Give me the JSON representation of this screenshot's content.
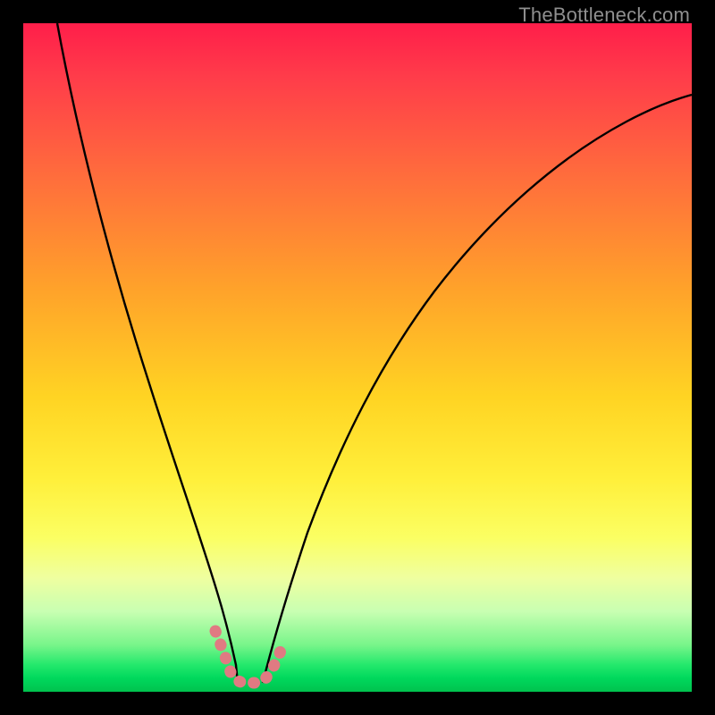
{
  "watermark": "TheBottleneck.com",
  "chart_data": {
    "type": "line",
    "title": "",
    "xlabel": "",
    "ylabel": "",
    "xlim": [
      0,
      100
    ],
    "ylim": [
      0,
      100
    ],
    "background": "gradient red-yellow-green (top-to-bottom)",
    "series": [
      {
        "name": "left-descending-curve",
        "x": [
          5,
          8,
          12,
          16,
          20,
          23,
          26,
          28,
          30,
          31
        ],
        "y": [
          100,
          90,
          75,
          58,
          40,
          25,
          14,
          7,
          3,
          1
        ],
        "color": "#000000"
      },
      {
        "name": "right-ascending-curve",
        "x": [
          36,
          38,
          42,
          48,
          56,
          66,
          78,
          90,
          100
        ],
        "y": [
          1,
          4,
          14,
          30,
          48,
          64,
          76,
          84,
          88
        ],
        "color": "#000000"
      },
      {
        "name": "highlight-band",
        "note": "pink rounded marker near trough",
        "x": [
          28,
          29,
          30,
          31,
          32,
          33,
          34,
          35,
          36,
          37,
          38
        ],
        "y": [
          7,
          4,
          2,
          1,
          1,
          1,
          1,
          1,
          1,
          3,
          6
        ],
        "color": "#e07a82"
      }
    ]
  },
  "colors": {
    "watermark": "#8f8f8f",
    "curve": "#000000",
    "highlight": "#e07a82"
  }
}
